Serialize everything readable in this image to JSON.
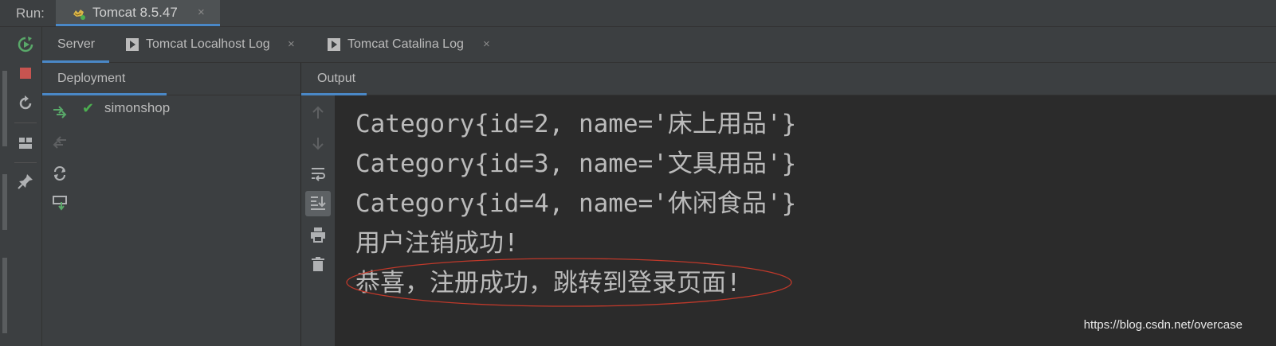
{
  "run_bar": {
    "label": "Run:",
    "tab": {
      "title": "Tomcat 8.5.47",
      "close": "×",
      "icon": "tomcat-icon"
    }
  },
  "sub_tabs": [
    {
      "label": "Server",
      "active": true
    },
    {
      "label": "Tomcat Localhost Log",
      "close": "×",
      "icon": "log-console-icon"
    },
    {
      "label": "Tomcat Catalina Log",
      "close": "×",
      "icon": "log-console-icon"
    }
  ],
  "deployment": {
    "header": "Deployment",
    "items": [
      {
        "name": "simonshop",
        "status_icon": "checkmark-icon",
        "status_color": "#4caf50"
      }
    ]
  },
  "output": {
    "header": "Output",
    "lines": [
      "Category{id=2, name='床上用品'}",
      "Category{id=3, name='文具用品'}",
      "Category{id=4, name='休闲食品'}",
      "用户注销成功!",
      "恭喜，注册成功，跳转到登录页面!"
    ],
    "highlight_color": "#c0392b"
  },
  "watermark": "https://blog.csdn.net/overcase",
  "colors": {
    "accent": "#4a88c7",
    "green": "#59a869",
    "red": "#c75450",
    "bg": "#2b2b2b",
    "panel": "#3c3f41"
  }
}
